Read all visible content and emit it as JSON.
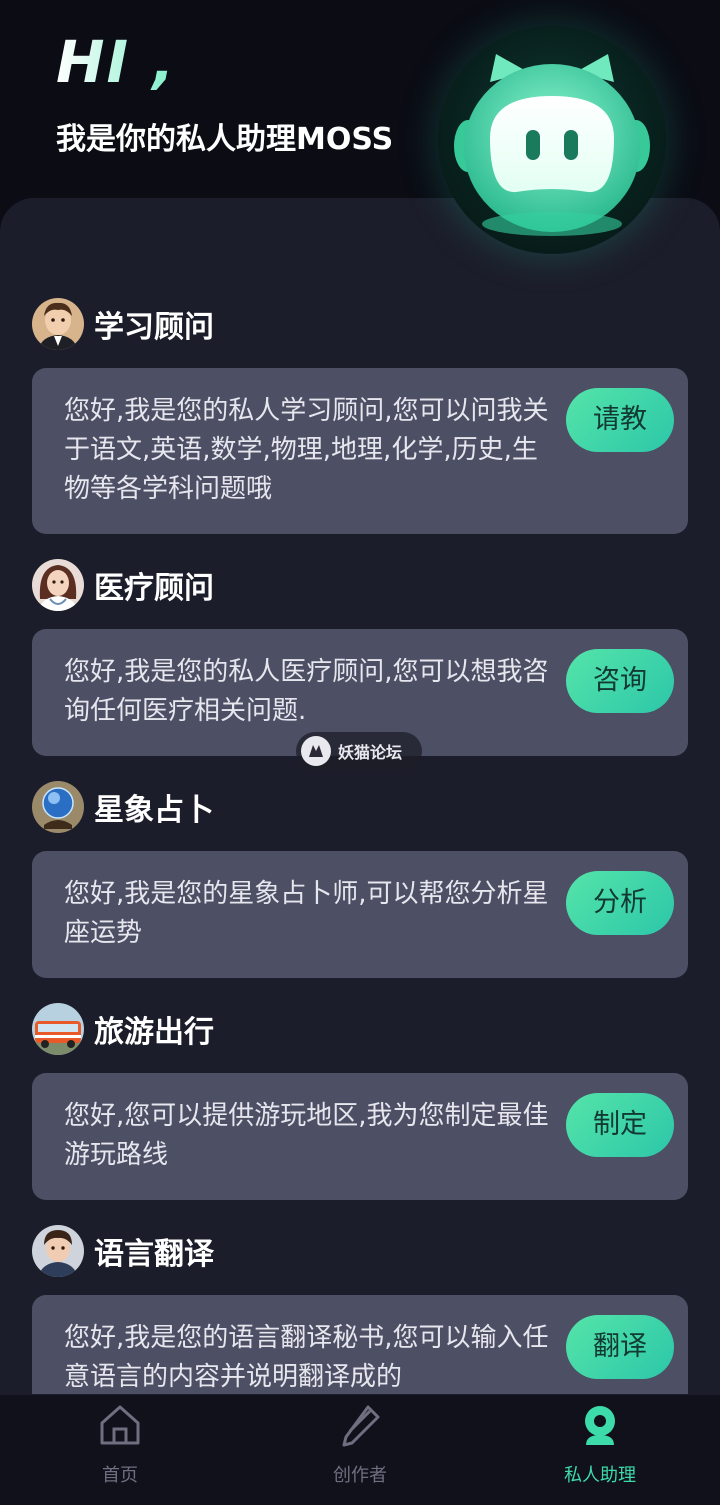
{
  "header": {
    "greeting": "HI ,",
    "intro": "我是你的私人助理MOSS"
  },
  "assistants": [
    {
      "title": "学习顾问",
      "avatar": "boy-student-avatar",
      "desc": "您好,我是您的私人学习顾问,您可以问我关于语文,英语,数学,物理,地理,化学,历史,生物等各学科问题哦",
      "button": "请教"
    },
    {
      "title": "医疗顾问",
      "avatar": "doctor-avatar",
      "desc": "您好,我是您的私人医疗顾问,您可以想我咨询任何医疗相关问题.",
      "button": "咨询"
    },
    {
      "title": "星象占卜",
      "avatar": "crystal-ball-avatar",
      "desc": "您好,我是您的星象占卜师,可以帮您分析星座运势",
      "button": "分析"
    },
    {
      "title": "旅游出行",
      "avatar": "bus-avatar",
      "desc": "您好,您可以提供游玩地区,我为您制定最佳游玩路线",
      "button": "制定"
    },
    {
      "title": "语言翻译",
      "avatar": "translator-avatar",
      "desc": "您好,我是您的语言翻译秘书,您可以输入任意语言的内容并说明翻译成的",
      "button": "翻译"
    }
  ],
  "watermark": "妖猫论坛",
  "tabbar": {
    "items": [
      {
        "label": "首页",
        "icon": "home-icon",
        "active": false
      },
      {
        "label": "创作者",
        "icon": "edit-icon",
        "active": false
      },
      {
        "label": "私人助理",
        "icon": "assistant-icon",
        "active": true
      }
    ]
  },
  "colors": {
    "background": "#0b0c14",
    "panel": "#1c1d2a",
    "card": "#4d4f64",
    "accent": "#3ddbaa",
    "tab_active": "#3ddbaa",
    "tab_inactive": "#6e6f80"
  }
}
